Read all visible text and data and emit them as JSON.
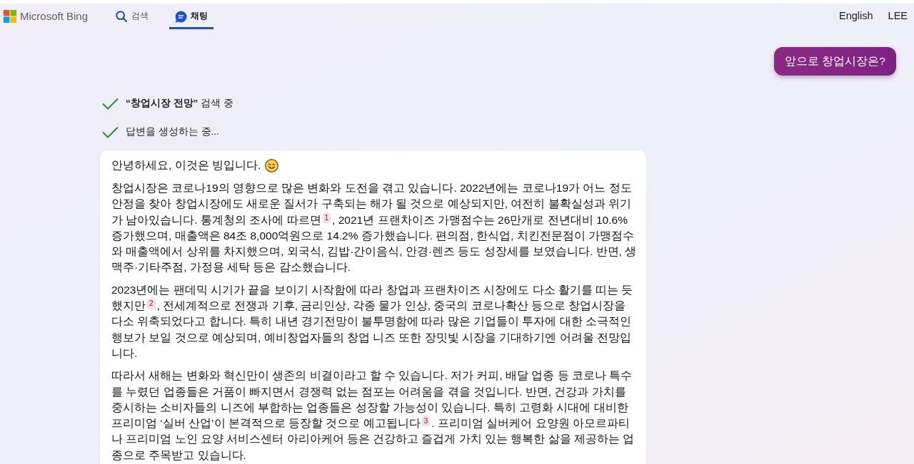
{
  "header": {
    "logo": "Microsoft Bing",
    "tabs": [
      {
        "label": "검색",
        "selected": false
      },
      {
        "label": "채팅",
        "selected": true
      }
    ],
    "links": [
      "English",
      "LEE"
    ]
  },
  "user_message": "앞으로 창업시장은?",
  "progress_steps": [
    {
      "text": "**“창업시장 전망”** 검색 중",
      "done": true
    },
    {
      "text": "답변을 생성하는 중...",
      "done": true
    }
  ],
  "response": {
    "greeting": "안녕하세요, 이것은 빙입니다.",
    "paragraphs": [
      {
        "segments": [
          {
            "kind": "text",
            "text": "창업시장은 코로나19의 영향으로 많은 변화와 도전을 겪고 있습니다. 2022년에는 코로나19가 어느 정도 안정을 찾아 창업시장에도 새로운 질서가 구축되는 해가 될 것으로 예상되지만, 여전히 불확실성과 위기가 남아있습니다. 통계청의 조사에 따르면"
          },
          {
            "kind": "citation",
            "text": "1"
          },
          {
            "kind": "text",
            "text": ", 2021년 프랜차이즈 가맹점수는 26만개로 전년대비 10.6% 증가했으며, 매출액은 84조 8,000억원으로 14.2% 증가했습니다. 편의점, 한식업, 치킨전문점이 가맹점수와 매출액에서 상위를 차지했으며, 외국식, 김밥·간이음식, 안경·렌즈 등도 성장세를 보였습니다. 반면, 생맥주·기타주점, 가정용 세탁 등은 감소했습니다."
          }
        ]
      },
      {
        "segments": [
          {
            "kind": "text",
            "text": "2023년에는 팬데믹 시기가 끝을 보이기 시작함에 따라 창업과 프랜차이즈 시장에도 다소 활기를 띠는 듯했지만"
          },
          {
            "kind": "citation",
            "text": "2"
          },
          {
            "kind": "text",
            "text": ", 전세계적으로 전쟁과 기후, 금리인상, 각종 물가 인상, 중국의 코로나확산 등으로 창업시장을 다소 위축되었다고 합니다. 특히 내년 경기전망이 불투명함에 따라 많은 기업들이 투자에 대한 소극적인 행보가 보일 것으로 예상되며, 예비창업자들의 창업 니즈 또한 장밋빛 시장을 기대하기엔 어려울 전망입니다."
          }
        ]
      },
      {
        "segments": [
          {
            "kind": "text",
            "text": "따라서 새해는 변화와 혁신만이 생존의 비결이라고 할 수 있습니다. 저가 커피, 배달 업종 등 코로나 특수를 누렸던 업종들은 거품이 빠지면서 경쟁력 없는 점포는 어려움을 겪을 것입니다. 반면, 건강과 가치를 중시하는 소비자들의 니즈에 부합하는 업종들은 성장할 가능성이 있습니다. 특히 고령화 시대에 대비한 프리미엄 ‘실버 산업’이 본격적으로 등장할 것으로 예고됩니다"
          },
          {
            "kind": "citation",
            "text": "3"
          },
          {
            "kind": "text",
            "text": ". 프리미엄 실버케어 요양원 아모르파티나 프리미엄 노인 요양 서비스센터 아리아케어 등은 건강하고 즐겁게 가치 있는 행복한 삶을 제공하는 업종으로 주목받고 있습니다."
          }
        ]
      }
    ]
  }
}
